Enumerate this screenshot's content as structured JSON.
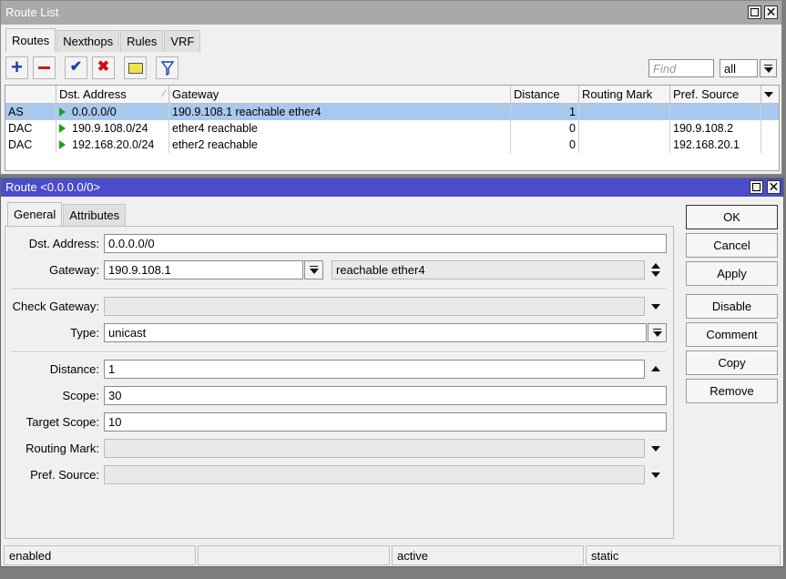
{
  "route_list": {
    "title": "Route List",
    "tabs": [
      "Routes",
      "Nexthops",
      "Rules",
      "VRF"
    ],
    "find_placeholder": "Find",
    "filter_value": "all",
    "columns": [
      "",
      "Dst. Address",
      "Gateway",
      "Distance",
      "Routing Mark",
      "Pref. Source"
    ],
    "rows": [
      {
        "flags": "AS",
        "dst": "0.0.0.0/0",
        "gateway": "190.9.108.1 reachable ether4",
        "distance": "1",
        "routing_mark": "",
        "pref_source": ""
      },
      {
        "flags": "DAC",
        "dst": "190.9.108.0/24",
        "gateway": "ether4 reachable",
        "distance": "0",
        "routing_mark": "",
        "pref_source": "190.9.108.2"
      },
      {
        "flags": "DAC",
        "dst": "192.168.20.0/24",
        "gateway": "ether2 reachable",
        "distance": "0",
        "routing_mark": "",
        "pref_source": "192.168.20.1"
      }
    ]
  },
  "route_window": {
    "title": "Route <0.0.0.0/0>",
    "tabs": [
      "General",
      "Attributes"
    ],
    "fields": {
      "dst_address": {
        "label": "Dst. Address:",
        "value": "0.0.0.0/0"
      },
      "gateway": {
        "label": "Gateway:",
        "value": "190.9.108.1",
        "state": "reachable ether4"
      },
      "check_gateway": {
        "label": "Check Gateway:",
        "value": ""
      },
      "type": {
        "label": "Type:",
        "value": "unicast"
      },
      "distance": {
        "label": "Distance:",
        "value": "1"
      },
      "scope": {
        "label": "Scope:",
        "value": "30"
      },
      "target_scope": {
        "label": "Target Scope:",
        "value": "10"
      },
      "routing_mark": {
        "label": "Routing Mark:",
        "value": ""
      },
      "pref_source": {
        "label": "Pref. Source:",
        "value": ""
      }
    },
    "buttons": {
      "ok": "OK",
      "cancel": "Cancel",
      "apply": "Apply",
      "disable": "Disable",
      "comment": "Comment",
      "copy": "Copy",
      "remove": "Remove"
    },
    "status": [
      "enabled",
      "",
      "active",
      "static"
    ]
  },
  "colors": {
    "selection": "#a9c8ee",
    "active_title": "#4a4cc9",
    "add_icon": "#1a3fb0",
    "remove_icon": "#c02020"
  }
}
